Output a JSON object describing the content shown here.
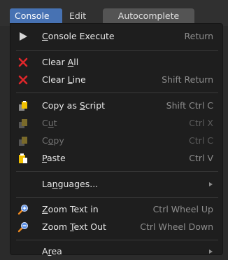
{
  "tabs": {
    "console": "Console",
    "edit": "Edit",
    "autocomplete": "Autocomplete"
  },
  "menu": {
    "items": [
      {
        "pre": "",
        "key": "C",
        "post": "onsole Execute",
        "shortcut": "Return",
        "icon": "play-icon"
      },
      {
        "pre": "Clear ",
        "key": "A",
        "post": "ll",
        "shortcut": "",
        "icon": "x-icon"
      },
      {
        "pre": "Clear ",
        "key": "L",
        "post": "ine",
        "shortcut": "Shift Return",
        "icon": "x-icon"
      },
      {
        "pre": "Copy as ",
        "key": "S",
        "post": "cript",
        "shortcut": "Shift Ctrl C",
        "icon": "copy-icon"
      },
      {
        "pre": "C",
        "key": "u",
        "post": "t",
        "shortcut": "Ctrl X",
        "icon": "copy-icon"
      },
      {
        "pre": "C",
        "key": "o",
        "post": "py",
        "shortcut": "Ctrl C",
        "icon": "copy-icon"
      },
      {
        "pre": "",
        "key": "P",
        "post": "aste",
        "shortcut": "Ctrl V",
        "icon": "paste-icon"
      },
      {
        "pre": "La",
        "key": "n",
        "post": "guages...",
        "shortcut": "",
        "icon": ""
      },
      {
        "pre": "",
        "key": "Z",
        "post": "oom Text in",
        "shortcut": "Ctrl Wheel Up",
        "icon": "zoom-in-icon"
      },
      {
        "pre": "Zoom ",
        "key": "T",
        "post": "ext Out",
        "shortcut": "Ctrl Wheel Down",
        "icon": "zoom-out-icon"
      },
      {
        "pre": "A",
        "key": "r",
        "post": "ea",
        "shortcut": "",
        "icon": ""
      }
    ]
  },
  "colors": {
    "accent": "#4772b3",
    "x_red": "#e0262a",
    "clipboard_yellow": "#f0c000",
    "zoom_blue": "#5a8fe6",
    "zoom_orange": "#f08a1e"
  }
}
